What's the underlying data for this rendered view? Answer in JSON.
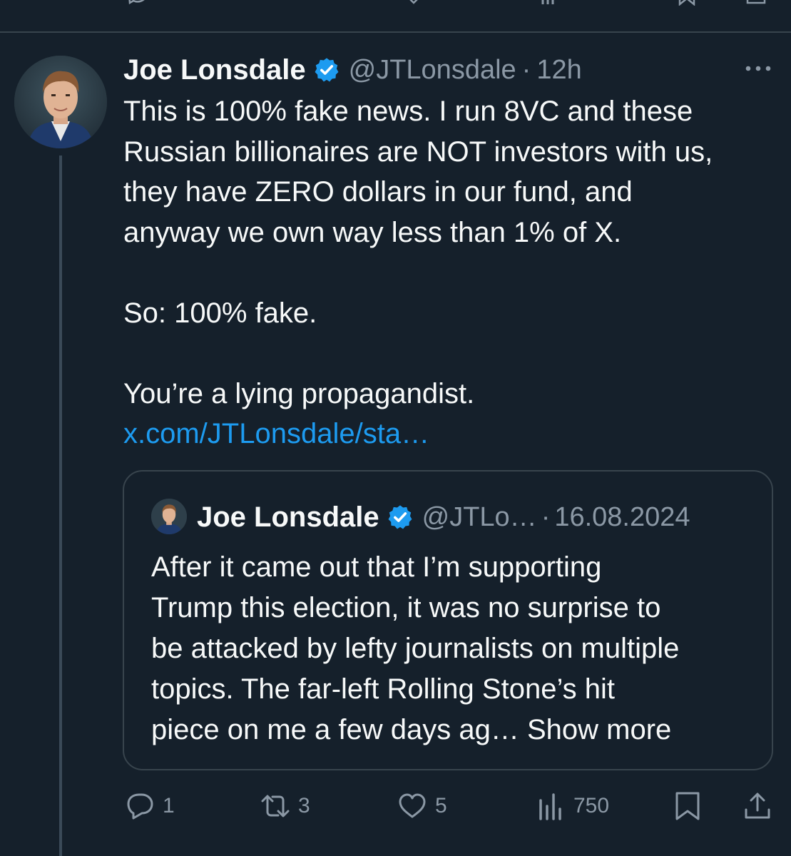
{
  "tweet": {
    "author_name": "Joe Lonsdale",
    "handle": "@JTLonsdale",
    "separator": "·",
    "time": "12h",
    "text_lines": [
      "This is 100% fake news. I run 8VC and these",
      "Russian billionaires are NOT investors with us,",
      "they have ZERO dollars in our fund, and",
      "anyway we own way less than 1% of X."
    ],
    "line2": "So: 100% fake.",
    "line3": "You’re a lying propagandist.",
    "link_text": "x.com/JTLonsdale/sta…",
    "more_icon": "ellipsis-icon",
    "verified_color": "#1d9bf0"
  },
  "quote": {
    "author_name": "Joe Lonsdale",
    "handle": "@JTLo…",
    "separator": "·",
    "date": "16.08.2024",
    "text_lines": [
      "After it came out that I’m supporting",
      "Trump this election, it was no surprise to",
      "be attacked by lefty journalists on multiple",
      "topics. The far-left Rolling Stone’s hit"
    ],
    "last_line": "piece on me a few days ag…",
    "show_more": "Show more"
  },
  "actions": {
    "reply_count": "1",
    "repost_count": "3",
    "like_count": "5",
    "views_count": "750"
  },
  "colors": {
    "background": "#15202b",
    "border": "#38444d",
    "secondary_text": "#8b98a5",
    "link": "#1d9bf0"
  }
}
